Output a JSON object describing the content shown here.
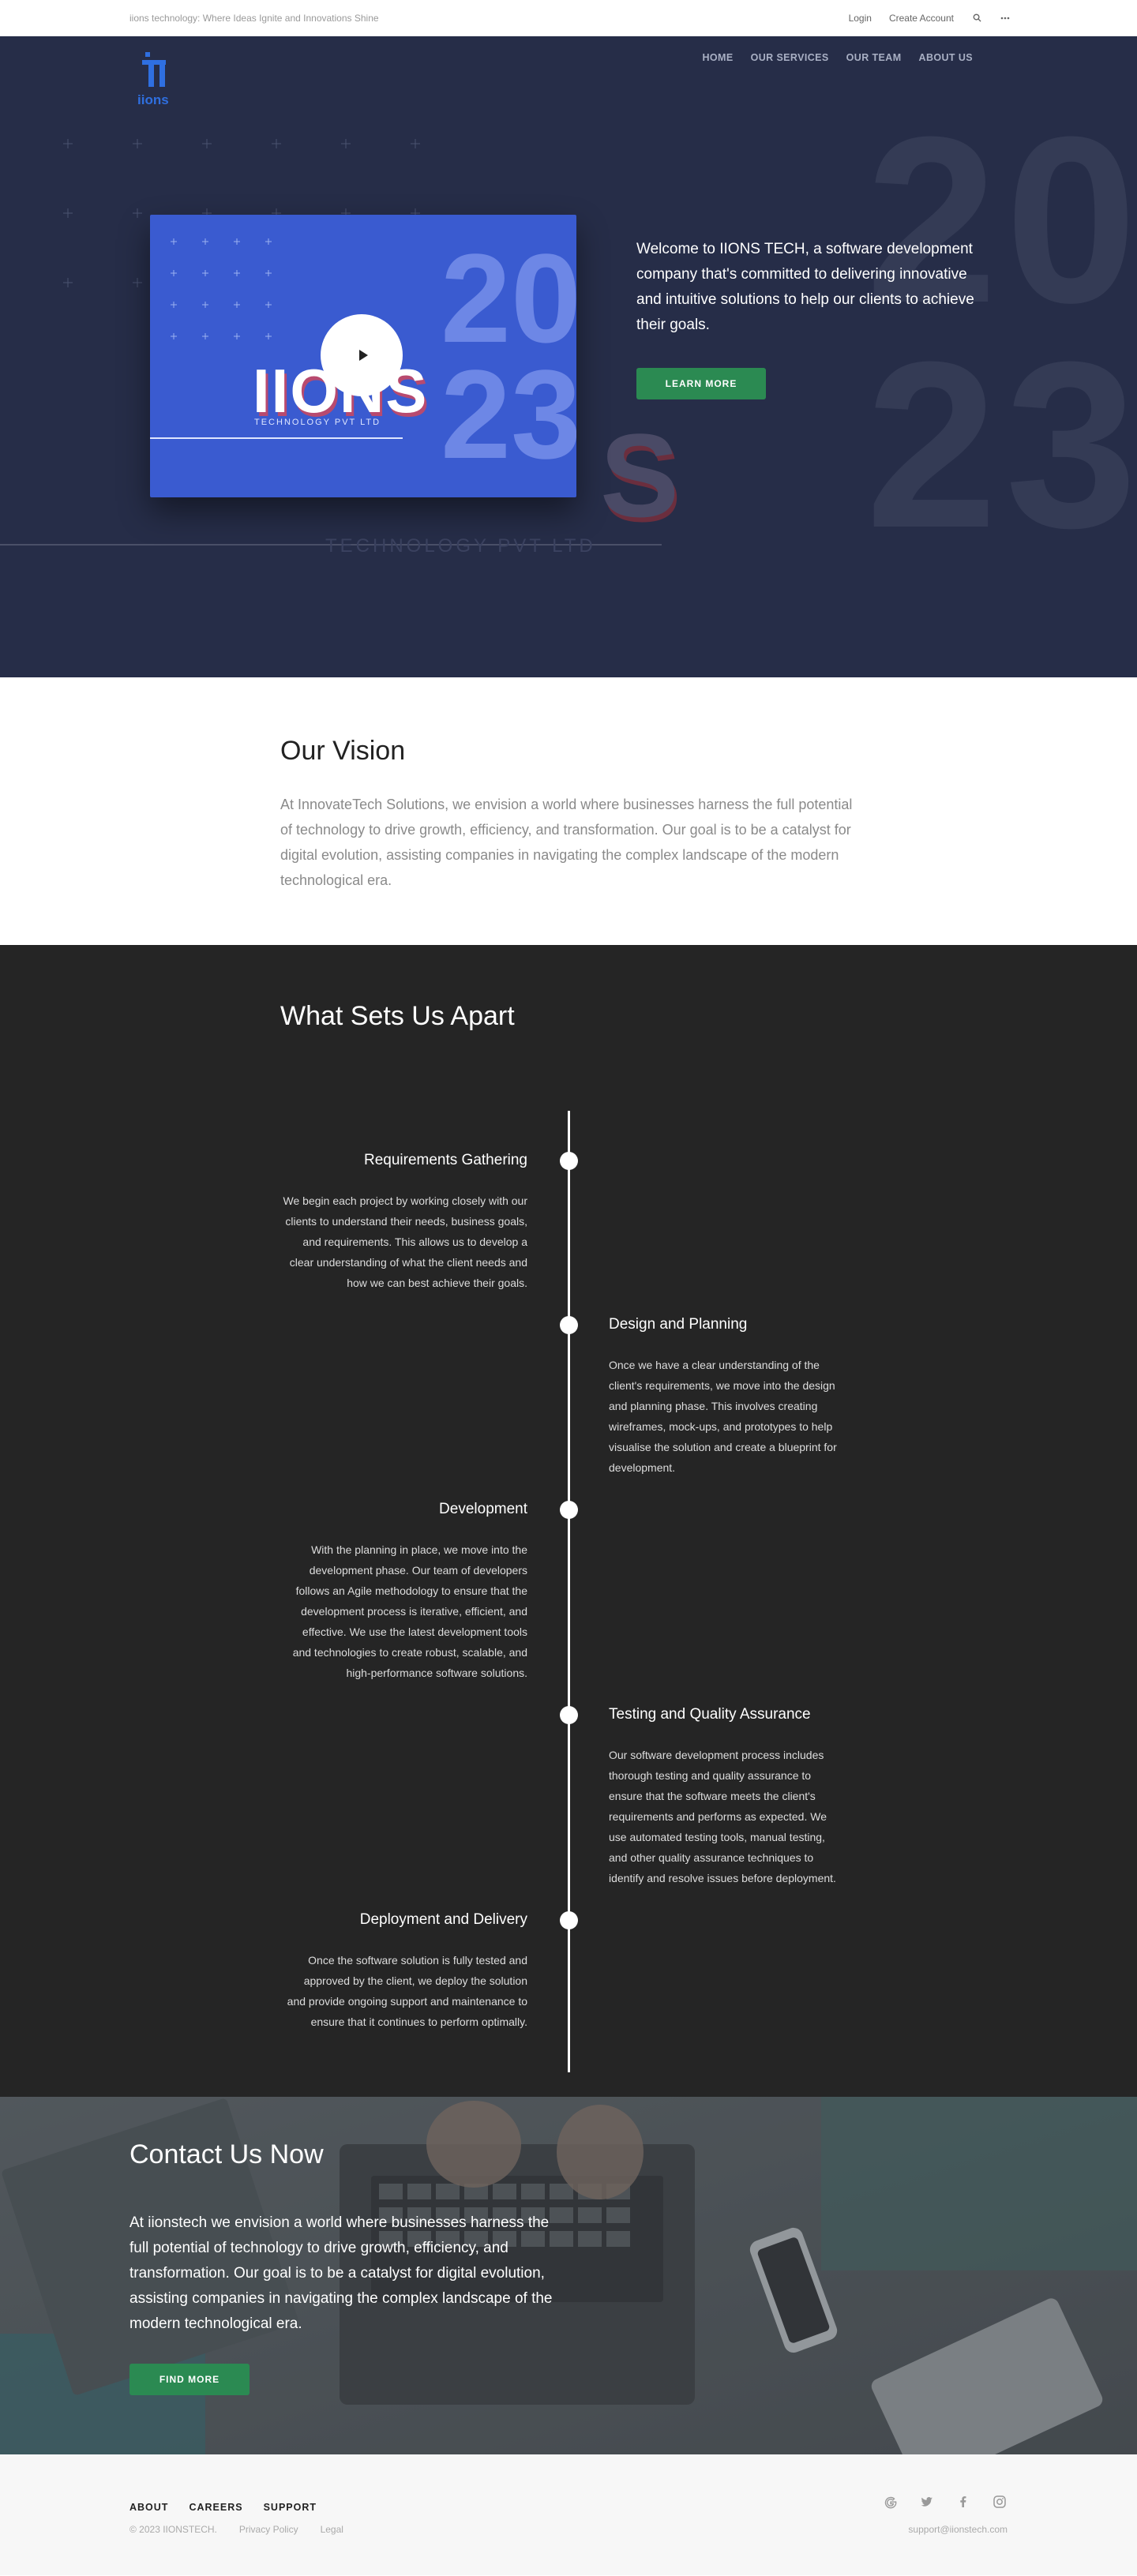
{
  "topbar": {
    "tagline": "iions technology: Where Ideas Ignite and Innovations Shine",
    "login": "Login",
    "create_account": "Create Account"
  },
  "hero": {
    "nav": [
      "HOME",
      "OUR SERVICES",
      "OUR TEAM",
      "ABOUT US"
    ],
    "bg_year_top": "20",
    "bg_year_bottom": "23",
    "card_year_top": "20",
    "card_year_bottom": "23",
    "brand": "IIONS",
    "brand_sub": "TECHNOLOGY PVT LTD",
    "ghost_sub": "TECHNOLOGY PVT LTD",
    "ghost_s": "S",
    "intro": "Welcome to IIONS TECH, a software development company that's committed to delivering innovative and intuitive solutions to help our clients to achieve their goals.",
    "learn_more": "LEARN MORE"
  },
  "logo": {
    "wordmark": "iions"
  },
  "vision": {
    "title": "Our Vision",
    "text": "At InnovateTech Solutions, we envision a world where businesses harness the full potential of technology to drive growth, efficiency, and transformation. Our goal is to be a catalyst for digital evolution, assisting companies in navigating the complex landscape of the modern technological era."
  },
  "apart": {
    "title": "What Sets Us Apart",
    "steps": [
      {
        "title": "Requirements Gathering",
        "text": "We begin each project by working closely with our clients to understand their needs, business goals, and requirements. This allows us to develop a clear understanding of what the client needs and how we can best achieve their goals."
      },
      {
        "title": "Design and Planning",
        "text": "Once we have a clear understanding of the client's requirements, we move into the design and planning phase. This involves creating wireframes, mock-ups, and prototypes to help visualise the solution and create a blueprint for development."
      },
      {
        "title": "Development",
        "text": "With the planning in place, we move into the development phase. Our team of developers follows an Agile methodology to ensure that the development process is iterative, efficient, and effective. We use the latest development tools and technologies to create robust, scalable, and high-performance software solutions."
      },
      {
        "title": "Testing and Quality Assurance",
        "text": "Our software development process includes thorough testing and quality assurance to ensure that the software meets the client's requirements and performs as expected. We use automated testing tools, manual testing, and other quality assurance techniques to identify and resolve issues before deployment."
      },
      {
        "title": "Deployment and Delivery",
        "text": "Once the software solution is fully tested and approved by the client, we deploy the solution and provide ongoing support and maintenance to ensure that it continues to perform optimally."
      }
    ]
  },
  "contact": {
    "title": "Contact Us Now",
    "text": "At iionstech we envision a world where businesses harness the full potential of technology to drive growth, efficiency, and transformation. Our goal is to be a catalyst for digital evolution, assisting companies in navigating the complex landscape of the modern technological era.",
    "button": "FIND MORE"
  },
  "footer": {
    "links": [
      "ABOUT",
      "CAREERS",
      "SUPPORT"
    ],
    "copyright": "© 2023 IIONSTECH.",
    "privacy": "Privacy Policy",
    "legal": "Legal",
    "email": "support@iionstech.com",
    "social": [
      "google-icon",
      "twitter-icon",
      "facebook-icon",
      "instagram-icon"
    ]
  },
  "colors": {
    "hero_bg": "#262d48",
    "card_blue": "#3a5bd0",
    "accent_green": "#2b8a52",
    "dark_section": "#252525",
    "logo_blue": "#2f6fe0"
  }
}
